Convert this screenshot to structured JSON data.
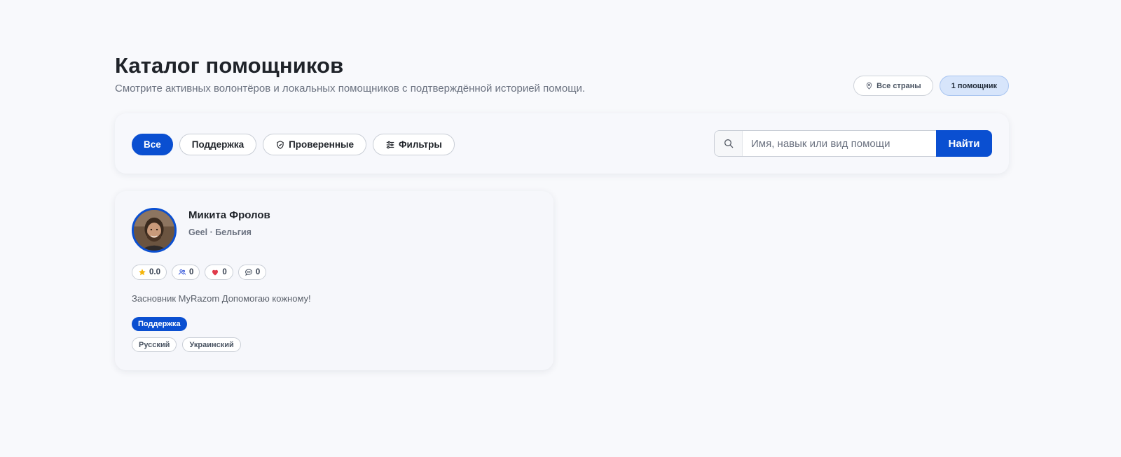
{
  "header": {
    "title": "Каталог помощников",
    "subtitle": "Смотрите активных волонтёров и локальных помощников с подтверждённой историей помощи.",
    "country_filter_label": "Все страны",
    "count_label": "1 помощник"
  },
  "filters": {
    "chips": [
      {
        "label": "Все",
        "active": true
      },
      {
        "label": "Поддержка",
        "active": false
      },
      {
        "label": "Проверенные",
        "active": false,
        "icon": "shield-icon"
      },
      {
        "label": "Фильтры",
        "active": false,
        "icon": "sliders-icon"
      }
    ],
    "search_placeholder": "Имя, навык или вид помощи",
    "search_value": "",
    "search_button_label": "Найти"
  },
  "helpers": [
    {
      "name": "Микита Фролов",
      "location": "Geel · Бельгия",
      "stats": {
        "rating": "0.0",
        "connections": "0",
        "likes": "0",
        "comments": "0"
      },
      "bio": "Засновник MyRazom Допомогаю кожному!",
      "category": "Поддержка",
      "languages": [
        "Русский",
        "Украинский"
      ]
    }
  ],
  "colors": {
    "accent": "#0a4fd1",
    "background": "#f8f9fc",
    "star": "#f5b50a",
    "heart": "#e03a4a"
  }
}
